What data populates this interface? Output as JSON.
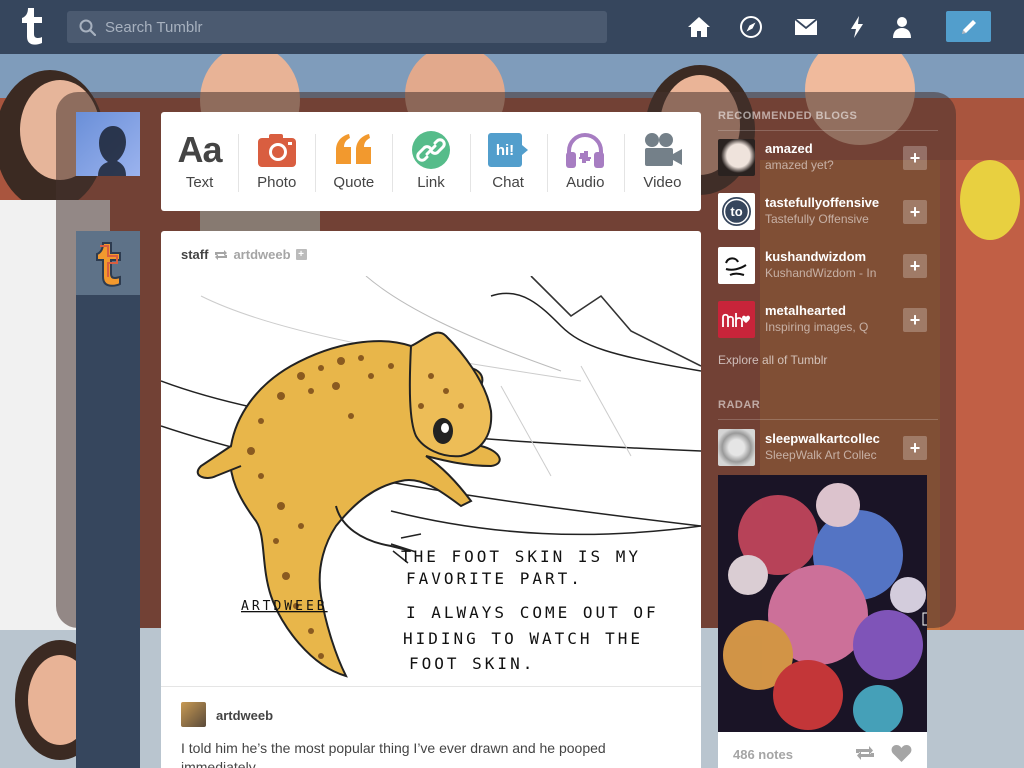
{
  "header": {
    "search_placeholder": "Search Tumblr"
  },
  "post_types": [
    {
      "label": "Text",
      "icon": "text-icon",
      "color": "#444444"
    },
    {
      "label": "Photo",
      "icon": "camera-icon",
      "color": "#d95e40"
    },
    {
      "label": "Quote",
      "icon": "quote-icon",
      "color": "#f2992e"
    },
    {
      "label": "Link",
      "icon": "link-icon",
      "color": "#56bc8a"
    },
    {
      "label": "Chat",
      "icon": "chat-icon",
      "color": "#529ecc"
    },
    {
      "label": "Audio",
      "icon": "headphones-icon",
      "color": "#a77dc2"
    },
    {
      "label": "Video",
      "icon": "video-camera-icon",
      "color": "#748089"
    }
  ],
  "post": {
    "reblogger": "staff",
    "source": "artdweeb",
    "source_user": "artdweeb",
    "caption": "I told him he’s the most popular thing I’ve ever drawn and he pooped immediately",
    "art": {
      "signature": "ARTDWEEB",
      "lines": [
        "THE FOOT SKIN IS MY",
        "FAVORITE PART.",
        "I ALWAYS COME OUT OF",
        "HIDING TO WATCH THE",
        "FOOT SKIN."
      ]
    }
  },
  "sidebar": {
    "recommended_title": "RECOMMENDED BLOGS",
    "blogs": [
      {
        "name": "amazed",
        "title": "amazed yet?"
      },
      {
        "name": "tastefullyoffensive",
        "title": "Tastefully Offensive"
      },
      {
        "name": "kushandwizdom",
        "title": "KushandWizdom - In"
      },
      {
        "name": "metalhearted",
        "title": "Inspiring images, Q"
      }
    ],
    "follow_label": "+",
    "explore": "Explore all of Tumblr",
    "radar_title": "RADAR",
    "radar": {
      "name": "sleepwalkartcollec",
      "title": "SleepWalk Art Collec",
      "notes": "486 notes"
    }
  }
}
